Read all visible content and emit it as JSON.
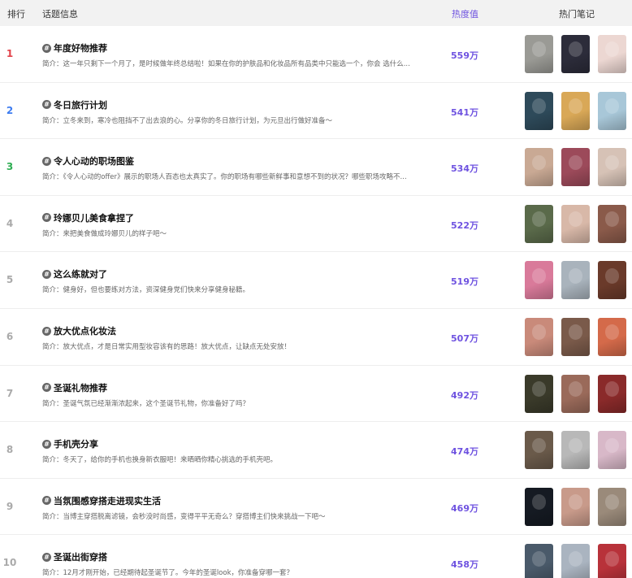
{
  "header": {
    "rank": "排行",
    "topic": "话题信息",
    "heat": "热度值",
    "notes": "热门笔记"
  },
  "colors": {
    "accent": "#6e52e0",
    "rank1": "#e2434a",
    "rank2": "#3d7cf0",
    "rank3": "#2fae54"
  },
  "rows": [
    {
      "rank": "1",
      "title": "年度好物推荐",
      "desc": "简介：这一年只剩下一个月了，是时候做年终总结啦！如果在你的护肤品和化妆品所有品类中只能选一个，你会 选什么...",
      "heat": "559万",
      "thumbs": [
        "#9a9a95",
        "#2c2c3a",
        "#ecd7d2"
      ]
    },
    {
      "rank": "2",
      "title": "冬日旅行计划",
      "desc": "简介：立冬来到，寒冷也阻挡不了出去浪的心。分享你的冬日旅行计划，为元旦出行做好准备～",
      "heat": "541万",
      "thumbs": [
        "#2e4a5a",
        "#d9a857",
        "#a8c7d8"
      ]
    },
    {
      "rank": "3",
      "title": "令人心动的职场图鉴",
      "desc": "简介：《令人心动的offer》展示的职场人百态也太真实了。你的职场有哪些新鲜事和意想不到的状况？哪些职场攻略不...",
      "heat": "534万",
      "thumbs": [
        "#c9a994",
        "#9c4a5a",
        "#d6c2b6"
      ]
    },
    {
      "rank": "4",
      "title": "玲娜贝儿美食拿捏了",
      "desc": "简介：来把美食做成玲娜贝儿的样子吧～",
      "heat": "522万",
      "thumbs": [
        "#5a6a4a",
        "#d8b8a8",
        "#8a5a4a"
      ]
    },
    {
      "rank": "5",
      "title": "这么练就对了",
      "desc": "简介：健身好，但也要练对方法，资深健身党们快来分享健身秘籍。",
      "heat": "519万",
      "thumbs": [
        "#d97a9a",
        "#a9b3bc",
        "#6a3a2a"
      ]
    },
    {
      "rank": "6",
      "title": "放大优点化妆法",
      "desc": "简介：放大优点，才是日常实用型妆容该有的思路！放大优点，让缺点无处安放！",
      "heat": "507万",
      "thumbs": [
        "#c98a7a",
        "#7a5a4a",
        "#d46a4a"
      ]
    },
    {
      "rank": "7",
      "title": "圣诞礼物推荐",
      "desc": "简介：圣诞气氛已经渐渐浓起来，这个圣诞节礼物，你准备好了吗？",
      "heat": "492万",
      "thumbs": [
        "#3a3a2a",
        "#9a6a5a",
        "#8a2a2a"
      ]
    },
    {
      "rank": "8",
      "title": "手机壳分享",
      "desc": "简介：冬天了，给你的手机也换身新衣服吧！来晒晒你精心挑选的手机壳吧。",
      "heat": "474万",
      "thumbs": [
        "#6a5a4a",
        "#b8b8b8",
        "#d8b8c8"
      ]
    },
    {
      "rank": "9",
      "title": "当氛围感穿搭走进现实生活",
      "desc": "简介：当博主穿搭脱离滤镜，会秒没时尚感，变得平平无奇么？穿搭博主们快来挑战一下吧～",
      "heat": "469万",
      "thumbs": [
        "#151a22",
        "#c89a8a",
        "#9a8a7a"
      ]
    },
    {
      "rank": "10",
      "title": "圣诞出街穿搭",
      "desc": "简介：12月才刚开始，已经期待起圣诞节了。今年的圣诞look，你准备穿哪一套？",
      "heat": "458万",
      "thumbs": [
        "#4a5a6a",
        "#aab4c0",
        "#b8323a"
      ]
    }
  ]
}
